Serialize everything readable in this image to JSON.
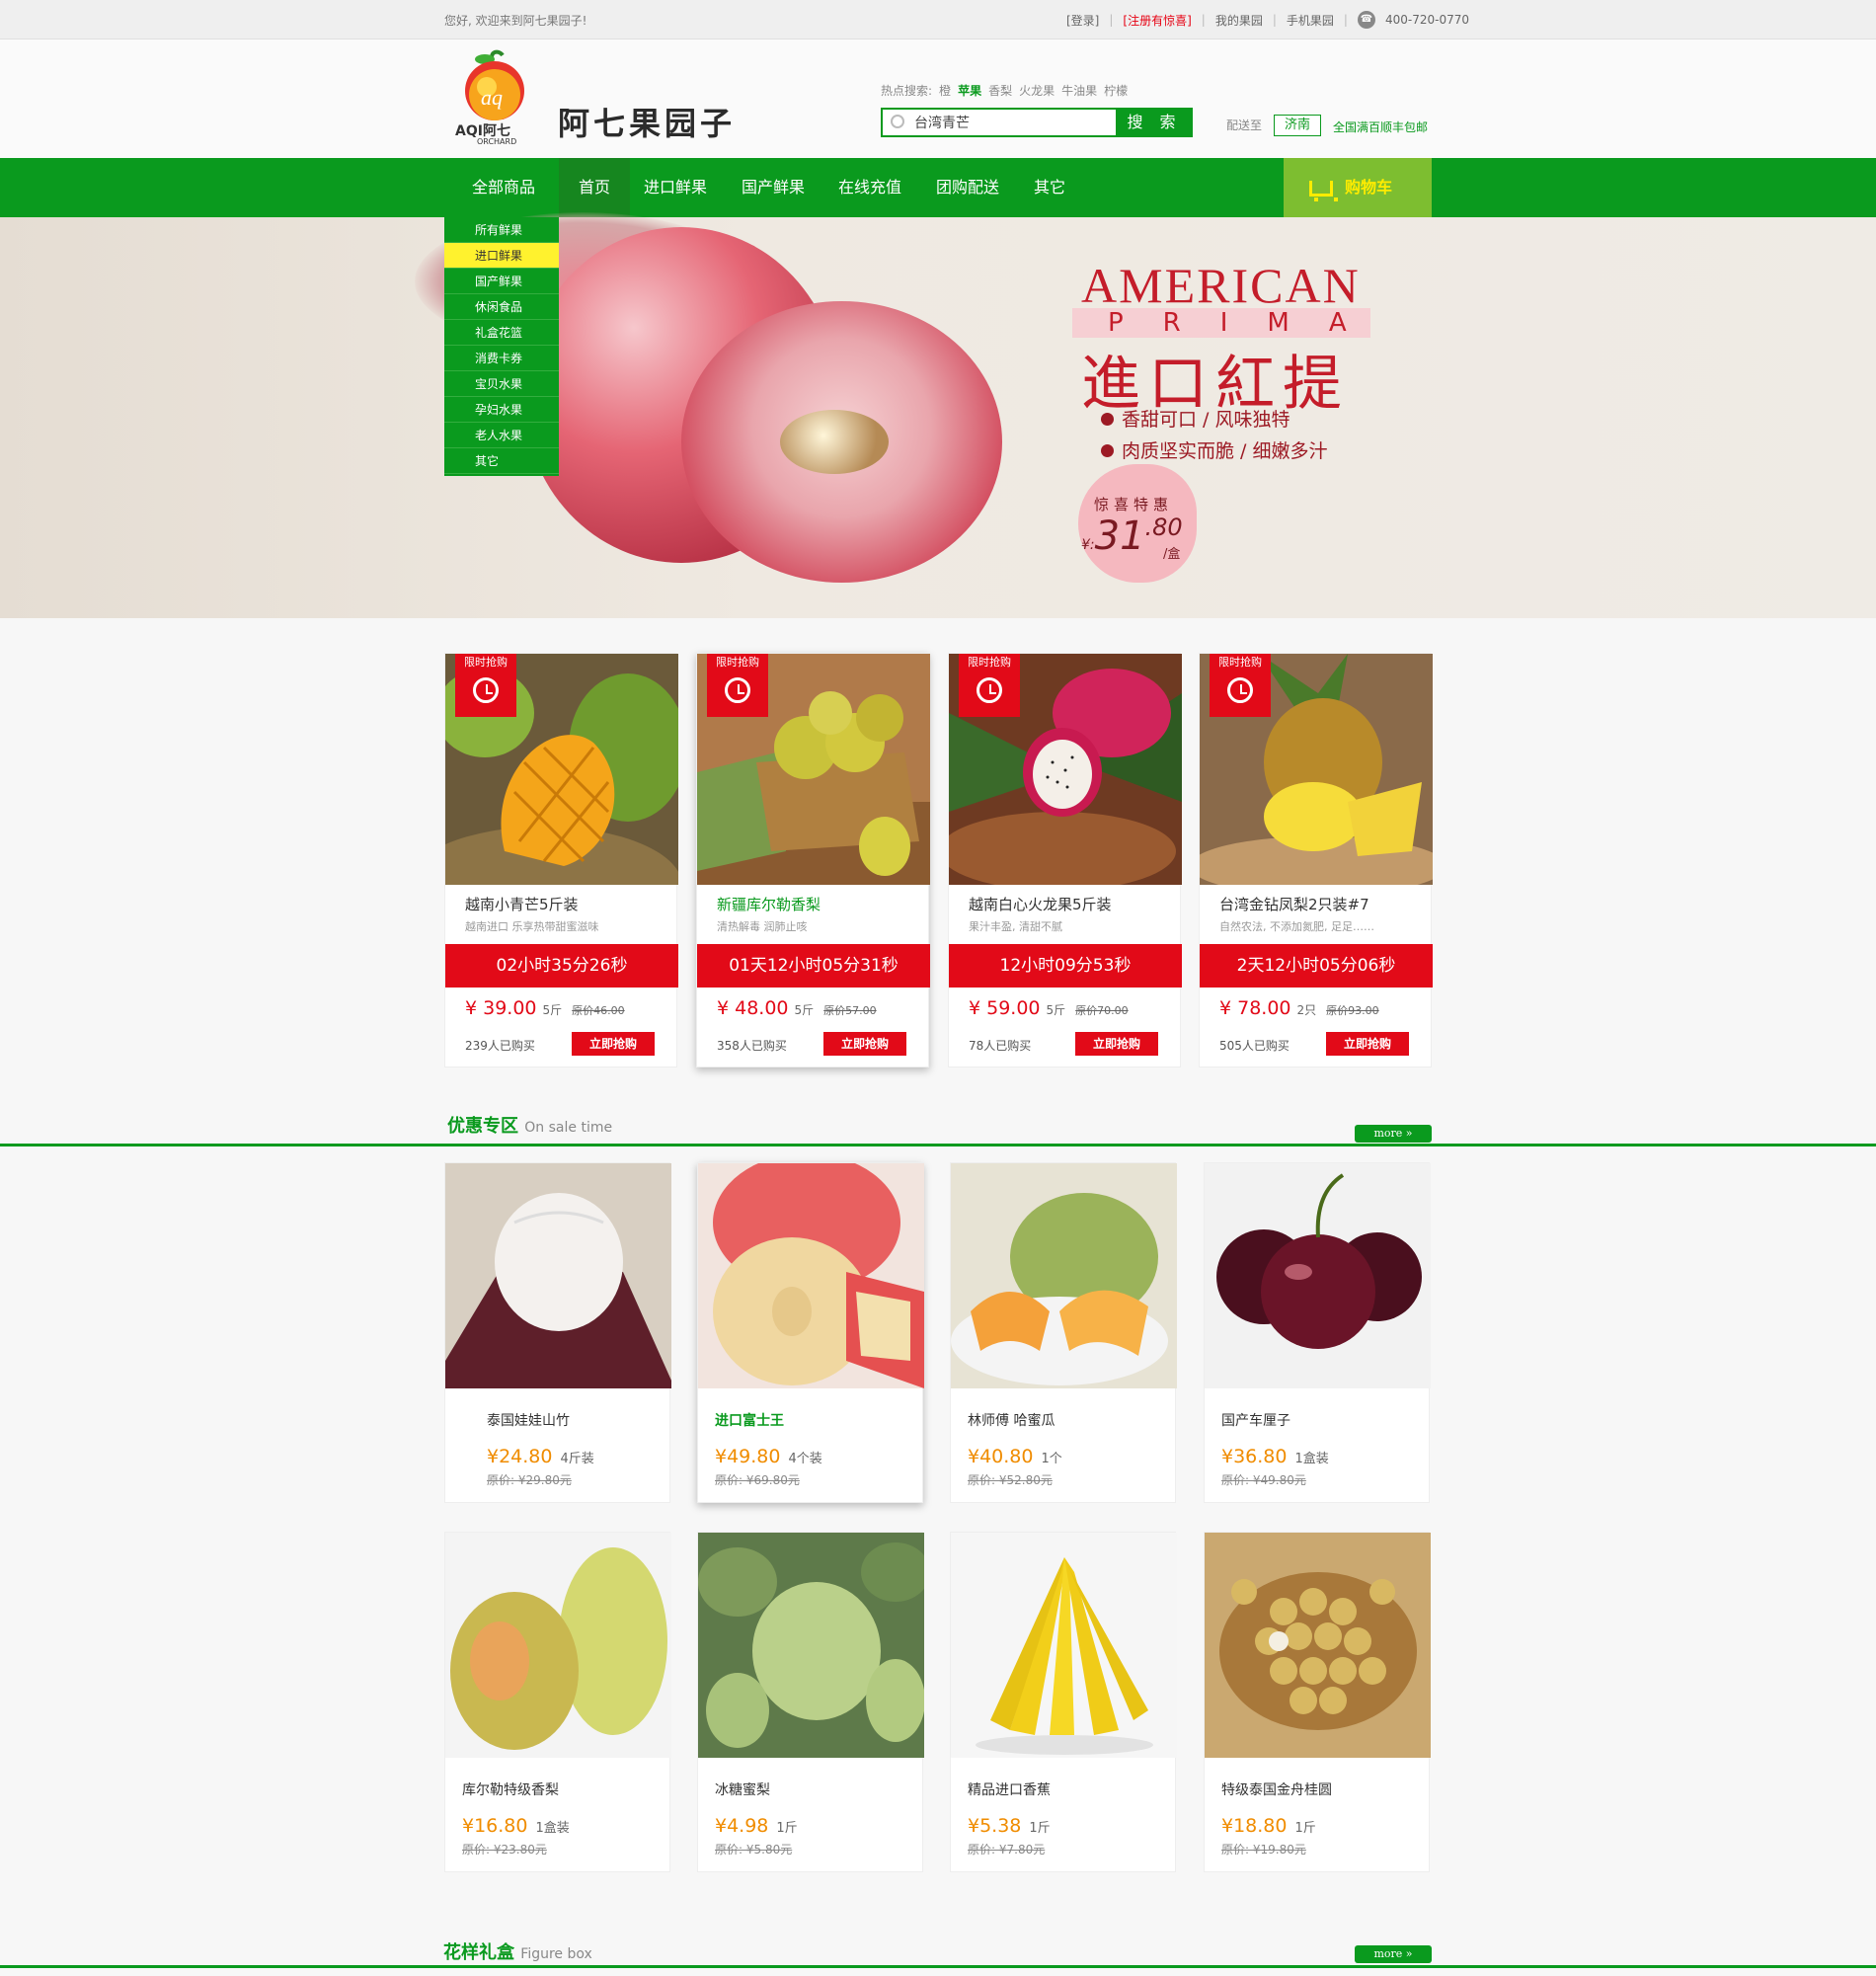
{
  "topbar": {
    "welcome": "您好, 欢迎来到阿七果园子!",
    "links": [
      {
        "label": "[登录]",
        "red": false
      },
      {
        "label": "[注册有惊喜]",
        "red": true
      },
      {
        "label": "我的果园",
        "red": false
      },
      {
        "label": "手机果园",
        "red": false
      }
    ],
    "phone": "400-720-0770"
  },
  "header": {
    "logo_text": "AQI阿七",
    "logo_sub": "ORCHARD",
    "site_name": "阿七果园子",
    "hot_label": "热点搜索:",
    "hot_items": [
      {
        "label": "橙",
        "highlight": false
      },
      {
        "label": "苹果",
        "highlight": true
      },
      {
        "label": "香梨",
        "highlight": false
      },
      {
        "label": "火龙果",
        "highlight": false
      },
      {
        "label": "牛油果",
        "highlight": false
      },
      {
        "label": "柠檬",
        "highlight": false
      }
    ],
    "search_value": "台湾青芒",
    "search_button": "搜 索",
    "deliver_label": "配送至",
    "city": "济南",
    "free_shipping": "全国满百顺丰包邮"
  },
  "nav": {
    "items": [
      "全部商品",
      "首页",
      "进口鲜果",
      "国产鲜果",
      "在线充值",
      "团购配送",
      "其它"
    ],
    "active": "首页",
    "cart": "购物车"
  },
  "categories": [
    "所有鲜果",
    "进口鲜果",
    "国产鲜果",
    "休闲食品",
    "礼盒花篮",
    "消费卡券",
    "宝贝水果",
    "孕妇水果",
    "老人水果",
    "其它"
  ],
  "categories_highlight": "进口鲜果",
  "banner": {
    "title_en": "AMERICAN",
    "subtitle_en": "PRIMA",
    "title_cn": "進口紅提",
    "features": [
      "香甜可口 / 风味独特",
      "肉质坚实而脆 / 细嫩多汁"
    ],
    "promo_label": "惊喜特惠",
    "currency": "¥:",
    "price_int": "31",
    "price_dec": ".80",
    "price_unit": "/盒"
  },
  "flash": {
    "badge": "限时抢购",
    "buy_label": "立即抢购",
    "items": [
      {
        "name": "越南小青芒5斤装",
        "desc": "越南进口 乐享热带甜蜜滋味",
        "timer": "02小时35分26秒",
        "price": "¥ 39.00",
        "unit": "5斤",
        "orig": "原价46.00",
        "sold": "239人已购买",
        "green": false
      },
      {
        "name": "新疆库尔勒香梨",
        "desc": "清热解毒 润肺止咳",
        "timer": "01天12小时05分31秒",
        "price": "¥ 48.00",
        "unit": "5斤",
        "orig": "原价57.00",
        "sold": "358人已购买",
        "green": true
      },
      {
        "name": "越南白心火龙果5斤装",
        "desc": "果汁丰盈, 清甜不腻",
        "timer": "12小时09分53秒",
        "price": "¥ 59.00",
        "unit": "5斤",
        "orig": "原价70.00",
        "sold": "78人已购买",
        "green": false
      },
      {
        "name": "台湾金钻凤梨2只装#7",
        "desc": "自然农法, 不添加氮肥, 足足……",
        "timer": "2天12小时05分06秒",
        "price": "¥ 78.00",
        "unit": "2只",
        "orig": "原价93.00",
        "sold": "505人已购买",
        "green": false
      }
    ]
  },
  "sale": {
    "title": "优惠专区",
    "subtitle": "On sale time",
    "more": "more »",
    "items": [
      {
        "name": "泰国娃娃山竹",
        "price": "¥24.80",
        "unit": "4斤装",
        "orig": "原价: ¥29.80元",
        "green": false
      },
      {
        "name": "进口富士王",
        "price": "¥49.80",
        "unit": "4个装",
        "orig": "原价: ¥69.80元",
        "green": true
      },
      {
        "name": "林师傅 哈蜜瓜",
        "price": "¥40.80",
        "unit": "1个",
        "orig": "原价: ¥52.80元",
        "green": false
      },
      {
        "name": "国产车厘子",
        "price": "¥36.80",
        "unit": "1盒装",
        "orig": "原价: ¥49.80元",
        "green": false
      },
      {
        "name": "库尔勒特级香梨",
        "price": "¥16.80",
        "unit": "1盒装",
        "orig": "原价: ¥23.80元",
        "green": false
      },
      {
        "name": "冰糖蜜梨",
        "price": "¥4.98",
        "unit": "1斤",
        "orig": "原价: ¥5.80元",
        "green": false
      },
      {
        "name": "精品进口香蕉",
        "price": "¥5.38",
        "unit": "1斤",
        "orig": "原价: ¥7.80元",
        "green": false
      },
      {
        "name": "特级泰国金舟桂圆",
        "price": "¥18.80",
        "unit": "1斤",
        "orig": "原价: ¥19.80元",
        "green": false
      }
    ]
  },
  "gift": {
    "title": "花样礼盒",
    "subtitle": "Figure box",
    "more": "more »"
  },
  "colors": {
    "brand_green": "#0a9a1e",
    "accent_red": "#e20a18",
    "price_orange": "#f08c00",
    "highlight_yellow": "#fff22e"
  }
}
